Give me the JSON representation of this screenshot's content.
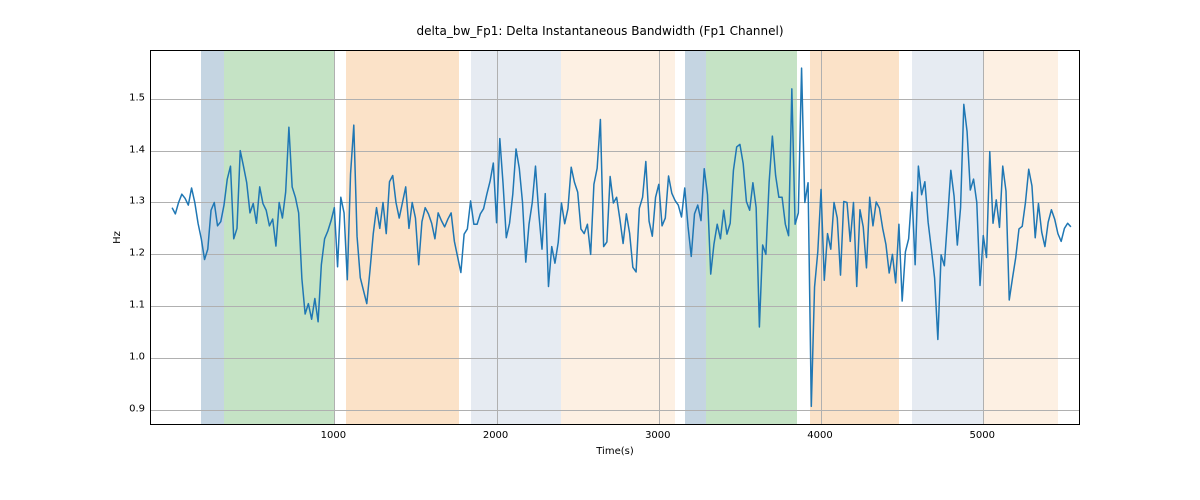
{
  "chart_data": {
    "type": "line",
    "title": "delta_bw_Fp1: Delta Instantaneous Bandwidth (Fp1 Channel)",
    "xlabel": "Time(s)",
    "ylabel": "Hz",
    "xlim": [
      -130,
      5590
    ],
    "ylim": [
      0.873,
      1.592
    ],
    "xticks": [
      1000,
      2000,
      3000,
      4000,
      5000
    ],
    "yticks": [
      0.9,
      1.0,
      1.1,
      1.2,
      1.3,
      1.4,
      1.5
    ],
    "bands": [
      {
        "start": 180,
        "end": 320,
        "color": "#8babc6",
        "opacity": 0.5
      },
      {
        "start": 320,
        "end": 1000,
        "color": "#8cc78c",
        "opacity": 0.5
      },
      {
        "start": 1070,
        "end": 1770,
        "color": "#f8c591",
        "opacity": 0.5
      },
      {
        "start": 1840,
        "end": 2400,
        "color": "#cdd8e6",
        "opacity": 0.5
      },
      {
        "start": 2400,
        "end": 3100,
        "color": "#fbe2c8",
        "opacity": 0.5
      },
      {
        "start": 3160,
        "end": 3290,
        "color": "#8babc6",
        "opacity": 0.5
      },
      {
        "start": 3290,
        "end": 3850,
        "color": "#8cc78c",
        "opacity": 0.5
      },
      {
        "start": 3930,
        "end": 4480,
        "color": "#f8c591",
        "opacity": 0.5
      },
      {
        "start": 4560,
        "end": 5000,
        "color": "#cdd8e6",
        "opacity": 0.5
      },
      {
        "start": 5000,
        "end": 5460,
        "color": "#fbe2c8",
        "opacity": 0.5
      }
    ],
    "series": [
      {
        "name": "delta_bw_Fp1",
        "color": "#1f77b4",
        "x_start": 0,
        "x_step": 20,
        "values": [
          1.29,
          1.278,
          1.3,
          1.316,
          1.308,
          1.295,
          1.328,
          1.3,
          1.26,
          1.23,
          1.19,
          1.21,
          1.285,
          1.3,
          1.255,
          1.263,
          1.295,
          1.345,
          1.37,
          1.23,
          1.25,
          1.4,
          1.37,
          1.338,
          1.28,
          1.298,
          1.26,
          1.33,
          1.298,
          1.285,
          1.255,
          1.268,
          1.216,
          1.3,
          1.27,
          1.32,
          1.445,
          1.33,
          1.31,
          1.28,
          1.153,
          1.085,
          1.105,
          1.075,
          1.115,
          1.07,
          1.18,
          1.23,
          1.245,
          1.265,
          1.29,
          1.176,
          1.31,
          1.28,
          1.151,
          1.355,
          1.449,
          1.235,
          1.155,
          1.13,
          1.105,
          1.17,
          1.24,
          1.29,
          1.25,
          1.3,
          1.24,
          1.34,
          1.352,
          1.3,
          1.27,
          1.3,
          1.33,
          1.25,
          1.3,
          1.27,
          1.18,
          1.263,
          1.29,
          1.278,
          1.26,
          1.23,
          1.28,
          1.265,
          1.253,
          1.268,
          1.28,
          1.225,
          1.195,
          1.165,
          1.239,
          1.249,
          1.303,
          1.258,
          1.258,
          1.278,
          1.288,
          1.316,
          1.341,
          1.376,
          1.261,
          1.423,
          1.336,
          1.232,
          1.26,
          1.316,
          1.403,
          1.366,
          1.3,
          1.185,
          1.258,
          1.3,
          1.37,
          1.28,
          1.21,
          1.317,
          1.138,
          1.215,
          1.183,
          1.223,
          1.299,
          1.259,
          1.288,
          1.368,
          1.339,
          1.32,
          1.249,
          1.24,
          1.258,
          1.2,
          1.335,
          1.366,
          1.46,
          1.215,
          1.224,
          1.35,
          1.299,
          1.31,
          1.268,
          1.221,
          1.278,
          1.241,
          1.175,
          1.166,
          1.289,
          1.31,
          1.379,
          1.264,
          1.235,
          1.31,
          1.335,
          1.255,
          1.27,
          1.351,
          1.318,
          1.304,
          1.295,
          1.272,
          1.328,
          1.254,
          1.196,
          1.278,
          1.295,
          1.265,
          1.365,
          1.315,
          1.162,
          1.22,
          1.258,
          1.23,
          1.285,
          1.239,
          1.26,
          1.362,
          1.407,
          1.412,
          1.375,
          1.302,
          1.285,
          1.338,
          1.29,
          1.06,
          1.218,
          1.2,
          1.339,
          1.428,
          1.352,
          1.31,
          1.31,
          1.258,
          1.236,
          1.519,
          1.258,
          1.28,
          1.559,
          1.3,
          1.338,
          0.907,
          1.137,
          1.205,
          1.325,
          1.15,
          1.24,
          1.21,
          1.3,
          1.27,
          1.16,
          1.302,
          1.3,
          1.225,
          1.3,
          1.138,
          1.286,
          1.253,
          1.174,
          1.31,
          1.255,
          1.301,
          1.289,
          1.25,
          1.219,
          1.164,
          1.2,
          1.145,
          1.258,
          1.11,
          1.205,
          1.23,
          1.32,
          1.18,
          1.37,
          1.315,
          1.34,
          1.262,
          1.21,
          1.154,
          1.036,
          1.199,
          1.178,
          1.268,
          1.362,
          1.312,
          1.218,
          1.29,
          1.489,
          1.437,
          1.324,
          1.345,
          1.3,
          1.14,
          1.236,
          1.194,
          1.398,
          1.26,
          1.305,
          1.252,
          1.37,
          1.322,
          1.112,
          1.154,
          1.194,
          1.249,
          1.254,
          1.3,
          1.364,
          1.332,
          1.232,
          1.298,
          1.243,
          1.215,
          1.262,
          1.286,
          1.268,
          1.24,
          1.225,
          1.25,
          1.26,
          1.253
        ]
      }
    ]
  }
}
